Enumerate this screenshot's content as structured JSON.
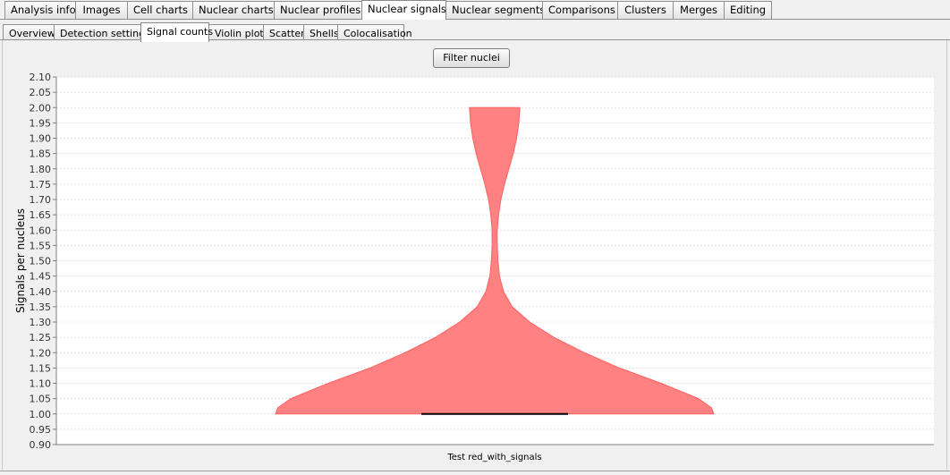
{
  "main_tabs": [
    {
      "label": "Analysis info",
      "active": false
    },
    {
      "label": "Images",
      "active": false
    },
    {
      "label": "Cell charts",
      "active": false
    },
    {
      "label": "Nuclear charts",
      "active": false
    },
    {
      "label": "Nuclear profiles",
      "active": false
    },
    {
      "label": "Nuclear signals",
      "active": true
    },
    {
      "label": "Nuclear segments",
      "active": false
    },
    {
      "label": "Comparisons",
      "active": false
    },
    {
      "label": "Clusters",
      "active": false
    },
    {
      "label": "Merges",
      "active": false
    },
    {
      "label": "Editing",
      "active": false
    }
  ],
  "sub_tabs": [
    {
      "label": "Overview",
      "active": false
    },
    {
      "label": "Detection settings",
      "active": false
    },
    {
      "label": "Signal counts",
      "active": true
    },
    {
      "label": "Violin plots",
      "active": false
    },
    {
      "label": "Scatter",
      "active": false
    },
    {
      "label": "Shells",
      "active": false
    },
    {
      "label": "Colocalisation",
      "active": false
    }
  ],
  "filter_button": "Filter nuclei",
  "colors": {
    "violin_fill": "#ff7a7a",
    "violin_stroke": "#ff6464",
    "median_line": "#000000",
    "gridline": "#d8d8d8"
  },
  "chart_data": {
    "type": "violin",
    "ylabel": "Signals per nucleus",
    "xlabel": "",
    "categories": [
      "Test red_with_signals"
    ],
    "ylim": [
      0.9,
      2.1
    ],
    "y_ticks": [
      "0.90",
      "0.95",
      "1.00",
      "1.05",
      "1.10",
      "1.15",
      "1.20",
      "1.25",
      "1.30",
      "1.35",
      "1.40",
      "1.45",
      "1.50",
      "1.55",
      "1.60",
      "1.65",
      "1.70",
      "1.75",
      "1.80",
      "1.85",
      "1.90",
      "1.95",
      "2.00",
      "2.05",
      "2.10"
    ],
    "grid": true,
    "series": [
      {
        "category": "Test red_with_signals",
        "median": 1.0,
        "density_profile": [
          {
            "y": 1.0,
            "w": 1.0
          },
          {
            "y": 1.02,
            "w": 0.99
          },
          {
            "y": 1.05,
            "w": 0.93
          },
          {
            "y": 1.1,
            "w": 0.76
          },
          {
            "y": 1.15,
            "w": 0.57
          },
          {
            "y": 1.2,
            "w": 0.41
          },
          {
            "y": 1.25,
            "w": 0.27
          },
          {
            "y": 1.3,
            "w": 0.16
          },
          {
            "y": 1.35,
            "w": 0.08
          },
          {
            "y": 1.4,
            "w": 0.04
          },
          {
            "y": 1.45,
            "w": 0.022
          },
          {
            "y": 1.5,
            "w": 0.015
          },
          {
            "y": 1.55,
            "w": 0.012
          },
          {
            "y": 1.6,
            "w": 0.012
          },
          {
            "y": 1.65,
            "w": 0.018
          },
          {
            "y": 1.7,
            "w": 0.028
          },
          {
            "y": 1.75,
            "w": 0.045
          },
          {
            "y": 1.8,
            "w": 0.065
          },
          {
            "y": 1.85,
            "w": 0.085
          },
          {
            "y": 1.9,
            "w": 0.1
          },
          {
            "y": 1.95,
            "w": 0.11
          },
          {
            "y": 2.0,
            "w": 0.115
          }
        ]
      }
    ]
  }
}
